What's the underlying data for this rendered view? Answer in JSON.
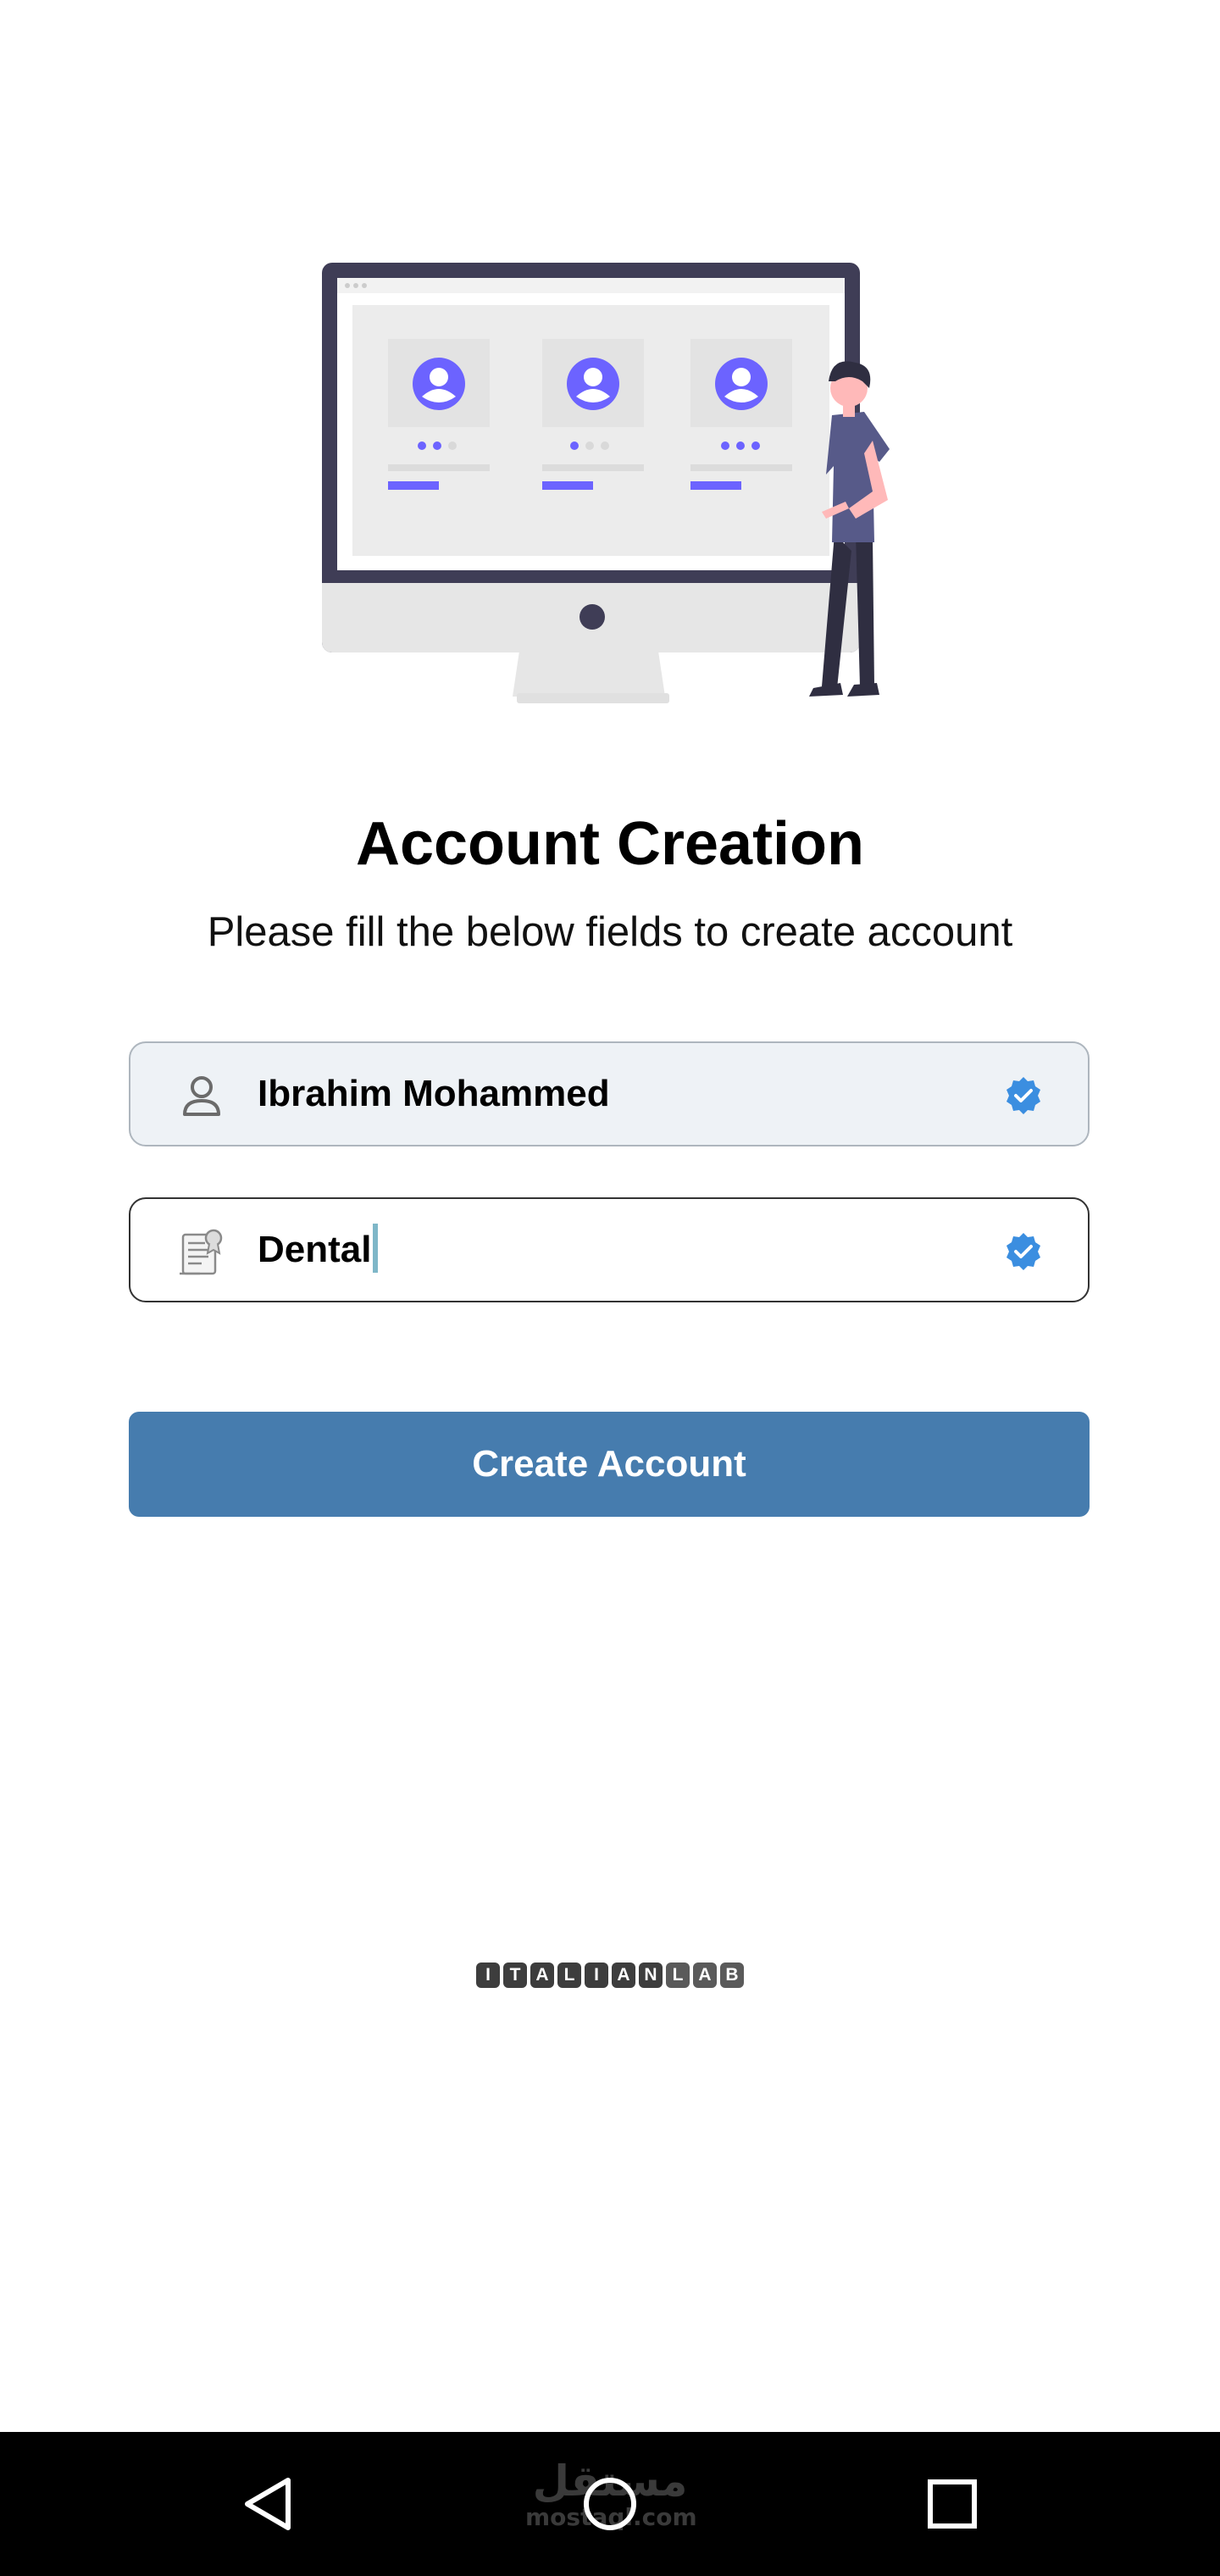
{
  "header": {
    "title": "Account Creation",
    "subtitle": "Please fill the below fields to create account"
  },
  "form": {
    "name_field": {
      "value": "Ibrahim Mohammed",
      "lead_icon": "person-icon",
      "trail_icon": "verified-badge-icon"
    },
    "specialty_field": {
      "value": "Dental",
      "lead_icon": "certificate-icon",
      "trail_icon": "verified-badge-icon"
    },
    "submit_label": "Create Account"
  },
  "brand": {
    "letters": [
      "I",
      "T",
      "A",
      "L",
      "I",
      "A",
      "N",
      "L",
      "A",
      "B"
    ]
  },
  "watermark": {
    "arabic": "مستقل",
    "latin": "mostaql.com"
  },
  "navbar": {
    "icons": [
      "back-triangle-icon",
      "home-circle-icon",
      "recent-square-icon"
    ]
  },
  "colors": {
    "accent": "#467cae",
    "verified": "#3b8ee0",
    "illustration_purple": "#6c63ff",
    "monitor_frame": "#3f3d56"
  }
}
